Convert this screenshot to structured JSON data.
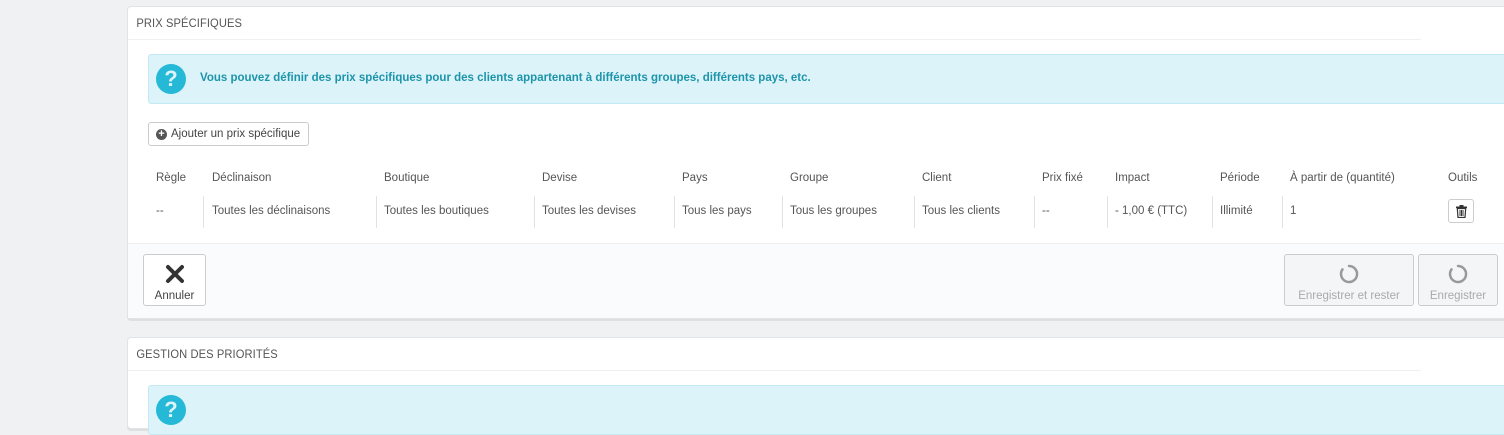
{
  "panel_specific": {
    "title": "PRIX SPÉCIFIQUES",
    "info": "Vous pouvez définir des prix spécifiques pour des clients appartenant à différents groupes, différents pays, etc.",
    "add_button": "Ajouter un prix spécifique",
    "table": {
      "headers": [
        "Règle",
        "Déclinaison",
        "Boutique",
        "Devise",
        "Pays",
        "Groupe",
        "Client",
        "Prix fixé",
        "Impact",
        "Période",
        "À partir de (quantité)",
        "Outils"
      ],
      "rows": [
        [
          "--",
          "Toutes les déclinaisons",
          "Toutes les boutiques",
          "Toutes les devises",
          "Tous les pays",
          "Tous les groupes",
          "Tous les clients",
          "--",
          "- 1,00 € (TTC)",
          "Illimité",
          "1"
        ]
      ]
    },
    "footer": {
      "cancel": "Annuler",
      "save_and_stay": "Enregistrer et rester",
      "save": "Enregistrer"
    }
  },
  "panel_priority": {
    "title": "GESTION DES PRIORITÉS"
  },
  "colors": {
    "background": "#eff1f2",
    "info_bg": "#dcf4f9",
    "info_text": "#1e94ab",
    "info_icon": "#25b9d7"
  }
}
